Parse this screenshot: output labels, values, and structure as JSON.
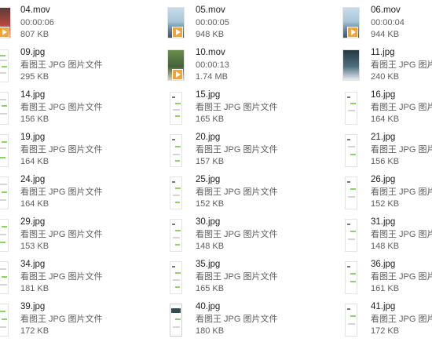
{
  "files": [
    {
      "name": "04.mov",
      "line2": "00:00:06",
      "line3": "807 KB",
      "thumb": "red-video-icon"
    },
    {
      "name": "05.mov",
      "line2": "00:00:05",
      "line3": "948 KB",
      "thumb": "sky-video-icon"
    },
    {
      "name": "06.mov",
      "line2": "00:00:04",
      "line3": "944 KB",
      "thumb": "sky-video-icon"
    },
    {
      "name": "09.jpg",
      "line2": "看图王 JPG 图片文件",
      "line3": "295 KB",
      "thumb": "document-icon"
    },
    {
      "name": "10.mov",
      "line2": "00:00:13",
      "line3": "1.74 MB",
      "thumb": "green-video-icon"
    },
    {
      "name": "11.jpg",
      "line2": "看图王 JPG 图片文件",
      "line3": "240 KB",
      "thumb": "photo-icon"
    },
    {
      "name": "14.jpg",
      "line2": "看图王 JPG 图片文件",
      "line3": "156 KB",
      "thumb": "document-icon"
    },
    {
      "name": "15.jpg",
      "line2": "看图王 JPG 图片文件",
      "line3": "165 KB",
      "thumb": "document-icon"
    },
    {
      "name": "16.jpg",
      "line2": "看图王 JPG 图片文件",
      "line3": "164 KB",
      "thumb": "document-icon"
    },
    {
      "name": "19.jpg",
      "line2": "看图王 JPG 图片文件",
      "line3": "164 KB",
      "thumb": "document-icon"
    },
    {
      "name": "20.jpg",
      "line2": "看图王 JPG 图片文件",
      "line3": "157 KB",
      "thumb": "document-icon"
    },
    {
      "name": "21.jpg",
      "line2": "看图王 JPG 图片文件",
      "line3": "156 KB",
      "thumb": "document-icon"
    },
    {
      "name": "24.jpg",
      "line2": "看图王 JPG 图片文件",
      "line3": "164 KB",
      "thumb": "document-icon"
    },
    {
      "name": "25.jpg",
      "line2": "看图王 JPG 图片文件",
      "line3": "152 KB",
      "thumb": "document-icon"
    },
    {
      "name": "26.jpg",
      "line2": "看图王 JPG 图片文件",
      "line3": "152 KB",
      "thumb": "document-icon"
    },
    {
      "name": "29.jpg",
      "line2": "看图王 JPG 图片文件",
      "line3": "153 KB",
      "thumb": "document-icon"
    },
    {
      "name": "30.jpg",
      "line2": "看图王 JPG 图片文件",
      "line3": "148 KB",
      "thumb": "document-icon"
    },
    {
      "name": "31.jpg",
      "line2": "看图王 JPG 图片文件",
      "line3": "148 KB",
      "thumb": "document-icon"
    },
    {
      "name": "34.jpg",
      "line2": "看图王 JPG 图片文件",
      "line3": "181 KB",
      "thumb": "document-icon"
    },
    {
      "name": "35.jpg",
      "line2": "看图王 JPG 图片文件",
      "line3": "165 KB",
      "thumb": "document-icon"
    },
    {
      "name": "36.jpg",
      "line2": "看图王 JPG 图片文件",
      "line3": "161 KB",
      "thumb": "document-icon"
    },
    {
      "name": "39.jpg",
      "line2": "看图王 JPG 图片文件",
      "line3": "172 KB",
      "thumb": "document-icon"
    },
    {
      "name": "40.jpg",
      "line2": "看图王 JPG 图片文件",
      "line3": "180 KB",
      "thumb": "document-icon"
    },
    {
      "name": "41.jpg",
      "line2": "看图王 JPG 图片文件",
      "line3": "172 KB",
      "thumb": "document-icon"
    }
  ]
}
